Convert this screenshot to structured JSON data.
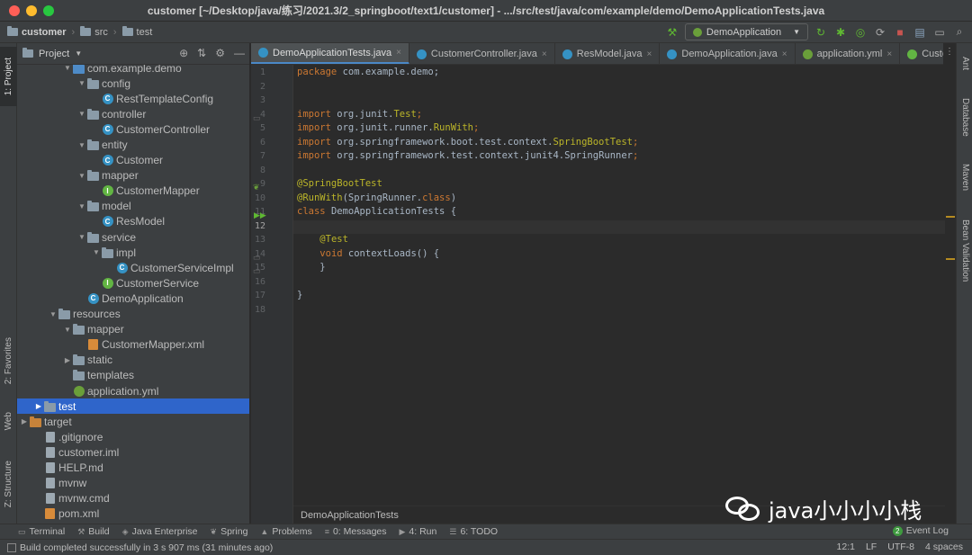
{
  "window": {
    "title": "customer [~/Desktop/java/练习/2021.3/2_springboot/text1/customer] - .../src/test/java/com/example/demo/DemoApplicationTests.java"
  },
  "navbar": {
    "crumbs": [
      "customer",
      "src",
      "test"
    ],
    "run_config": "DemoApplication"
  },
  "left_strip": {
    "tabs": [
      "1: Project",
      "2: Favorites",
      "Web",
      "Z: Structure"
    ]
  },
  "project": {
    "title": "Project",
    "tree": [
      {
        "label": "com.example.demo",
        "indent": 4,
        "arrow": "▼",
        "icon": "folder-blue"
      },
      {
        "label": "config",
        "indent": 5,
        "arrow": "▼",
        "icon": "folder"
      },
      {
        "label": "RestTemplateConfig",
        "indent": 6,
        "arrow": "",
        "icon": "class"
      },
      {
        "label": "controller",
        "indent": 5,
        "arrow": "▼",
        "icon": "folder"
      },
      {
        "label": "CustomerController",
        "indent": 6,
        "arrow": "",
        "icon": "class"
      },
      {
        "label": "entity",
        "indent": 5,
        "arrow": "▼",
        "icon": "folder"
      },
      {
        "label": "Customer",
        "indent": 6,
        "arrow": "",
        "icon": "class"
      },
      {
        "label": "mapper",
        "indent": 5,
        "arrow": "▼",
        "icon": "folder"
      },
      {
        "label": "CustomerMapper",
        "indent": 6,
        "arrow": "",
        "icon": "interface"
      },
      {
        "label": "model",
        "indent": 5,
        "arrow": "▼",
        "icon": "folder"
      },
      {
        "label": "ResModel",
        "indent": 6,
        "arrow": "",
        "icon": "class"
      },
      {
        "label": "service",
        "indent": 5,
        "arrow": "▼",
        "icon": "folder"
      },
      {
        "label": "impl",
        "indent": 6,
        "arrow": "▼",
        "icon": "folder"
      },
      {
        "label": "CustomerServiceImpl",
        "indent": 7,
        "arrow": "",
        "icon": "class"
      },
      {
        "label": "CustomerService",
        "indent": 6,
        "arrow": "",
        "icon": "interface"
      },
      {
        "label": "DemoApplication",
        "indent": 5,
        "arrow": "",
        "icon": "class"
      },
      {
        "label": "resources",
        "indent": 3,
        "arrow": "▼",
        "icon": "folder-res"
      },
      {
        "label": "mapper",
        "indent": 4,
        "arrow": "▼",
        "icon": "folder"
      },
      {
        "label": "CustomerMapper.xml",
        "indent": 5,
        "arrow": "",
        "icon": "xml"
      },
      {
        "label": "static",
        "indent": 4,
        "arrow": "▶",
        "icon": "folder"
      },
      {
        "label": "templates",
        "indent": 4,
        "arrow": "",
        "icon": "folder"
      },
      {
        "label": "application.yml",
        "indent": 4,
        "arrow": "",
        "icon": "yml"
      },
      {
        "label": "test",
        "indent": 2,
        "arrow": "▶",
        "icon": "folder",
        "selected": true
      },
      {
        "label": "target",
        "indent": 1,
        "arrow": "▶",
        "icon": "folder-orange"
      },
      {
        "label": ".gitignore",
        "indent": 2,
        "arrow": "",
        "icon": "file"
      },
      {
        "label": "customer.iml",
        "indent": 2,
        "arrow": "",
        "icon": "file"
      },
      {
        "label": "HELP.md",
        "indent": 2,
        "arrow": "",
        "icon": "file"
      },
      {
        "label": "mvnw",
        "indent": 2,
        "arrow": "",
        "icon": "file"
      },
      {
        "label": "mvnw.cmd",
        "indent": 2,
        "arrow": "",
        "icon": "file"
      },
      {
        "label": "pom.xml",
        "indent": 2,
        "arrow": "",
        "icon": "xml"
      }
    ]
  },
  "tabs": [
    {
      "label": "DemoApplicationTests.java",
      "active": true,
      "icon": "class"
    },
    {
      "label": "CustomerController.java",
      "active": false,
      "icon": "class"
    },
    {
      "label": "ResModel.java",
      "active": false,
      "icon": "class"
    },
    {
      "label": "DemoApplication.java",
      "active": false,
      "icon": "class"
    },
    {
      "label": "application.yml",
      "active": false,
      "icon": "yml"
    },
    {
      "label": "CustomerM",
      "active": false,
      "icon": "interface"
    }
  ],
  "editor": {
    "current_line": 12,
    "lines": [
      [
        {
          "t": "package ",
          "c": "kw"
        },
        {
          "t": "com.example.demo;",
          "c": "ident"
        }
      ],
      [],
      [],
      [
        {
          "t": "import ",
          "c": "kw"
        },
        {
          "t": "org.junit.",
          "c": "ident"
        },
        {
          "t": "Test",
          "c": "ann"
        },
        {
          "t": ";",
          "c": "kw"
        }
      ],
      [
        {
          "t": "import ",
          "c": "kw"
        },
        {
          "t": "org.junit.runner.",
          "c": "ident"
        },
        {
          "t": "RunWith",
          "c": "ann"
        },
        {
          "t": ";",
          "c": "kw"
        }
      ],
      [
        {
          "t": "import ",
          "c": "kw"
        },
        {
          "t": "org.springframework.boot.test.context.",
          "c": "ident"
        },
        {
          "t": "SpringBootTest",
          "c": "ann"
        },
        {
          "t": ";",
          "c": "kw"
        }
      ],
      [
        {
          "t": "import ",
          "c": "kw"
        },
        {
          "t": "org.springframework.test.context.junit4.",
          "c": "ident"
        },
        {
          "t": "SpringRunner",
          "c": "ident"
        },
        {
          "t": ";",
          "c": "kw"
        }
      ],
      [],
      [
        {
          "t": "@SpringBootTest",
          "c": "ann"
        }
      ],
      [
        {
          "t": "@RunWith",
          "c": "ann"
        },
        {
          "t": "(SpringRunner.",
          "c": "ident"
        },
        {
          "t": "class",
          "c": "kw"
        },
        {
          "t": ")",
          "c": "ident"
        }
      ],
      [
        {
          "t": "class ",
          "c": "kw"
        },
        {
          "t": "DemoApplicationTests {",
          "c": "ident"
        }
      ],
      [],
      [
        {
          "t": "    ",
          "c": "ident"
        },
        {
          "t": "@Test",
          "c": "ann"
        }
      ],
      [
        {
          "t": "    ",
          "c": "ident"
        },
        {
          "t": "void ",
          "c": "kw"
        },
        {
          "t": "contextLoads",
          "c": "ident"
        },
        {
          "t": "() {",
          "c": "ident"
        }
      ],
      [
        {
          "t": "    }",
          "c": "ident"
        }
      ],
      [],
      [
        {
          "t": "}",
          "c": "ident"
        }
      ],
      []
    ],
    "breadcrumb": "DemoApplicationTests"
  },
  "right_strip": {
    "tabs": [
      "Ant",
      "Database",
      "Maven",
      "Bean Validation"
    ]
  },
  "bottom_tools": [
    {
      "label": "Terminal",
      "icon": "terminal-icon",
      "glyph": "▭"
    },
    {
      "label": "Build",
      "icon": "hammer-icon",
      "glyph": "⚒"
    },
    {
      "label": "Java Enterprise",
      "icon": "java-enterprise-icon",
      "glyph": "◈"
    },
    {
      "label": "Spring",
      "icon": "spring-icon",
      "glyph": "❦"
    },
    {
      "label": "Problems",
      "icon": "warning-icon",
      "glyph": "▲"
    },
    {
      "label": "0: Messages",
      "icon": "messages-icon",
      "glyph": "≡"
    },
    {
      "label": "4: Run",
      "icon": "run-icon",
      "glyph": "▶"
    },
    {
      "label": "6: TODO",
      "icon": "todo-icon",
      "glyph": "☰"
    }
  ],
  "event_log": {
    "label": "Event Log",
    "count": "2"
  },
  "status": {
    "message": "Build completed successfully in 3 s 907 ms (31 minutes ago)",
    "position": "12:1",
    "line_sep": "LF",
    "encoding": "UTF-8",
    "indent": "4 spaces"
  },
  "watermark": {
    "text": "java小小小小栈"
  },
  "colors": {
    "selection": "#2f65ca",
    "keyword": "#cc7832",
    "annotation": "#bbb529",
    "identifier": "#a9b7c6"
  }
}
